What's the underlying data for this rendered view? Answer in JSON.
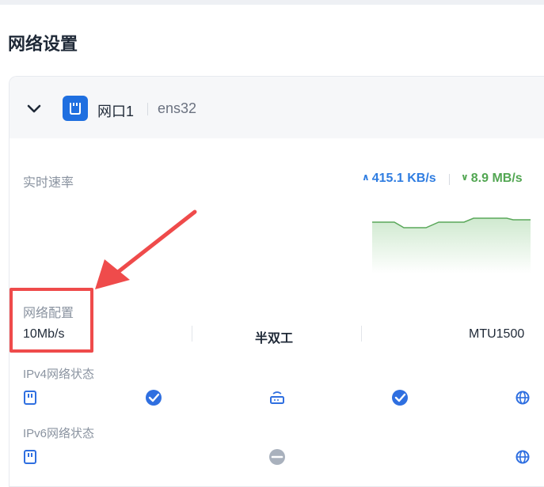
{
  "page": {
    "title": "网络设置"
  },
  "port": {
    "name": "网口1",
    "interface": "ens32"
  },
  "speed": {
    "label": "实时速率",
    "upload": "415.1 KB/s",
    "download": "8.9 MB/s",
    "upload_color": "#2f7de1",
    "download_color": "#52a652"
  },
  "config": {
    "label": "网络配置",
    "link_speed": "10Mb/s",
    "duplex": "半双工",
    "mtu": "MTU1500"
  },
  "ipv4": {
    "label": "IPv4网络状态",
    "link_ok": true,
    "internet_ok": true
  },
  "ipv6": {
    "label": "IPv6网络状态",
    "status": "disabled"
  },
  "colors": {
    "accent": "#1f6fe0",
    "annotation": "#ef4b4b"
  },
  "icons": [
    "chevron-down-icon",
    "ethernet-port-icon",
    "nic-icon",
    "router-icon",
    "check-circle-icon",
    "globe-icon",
    "minus-circle-icon"
  ]
}
